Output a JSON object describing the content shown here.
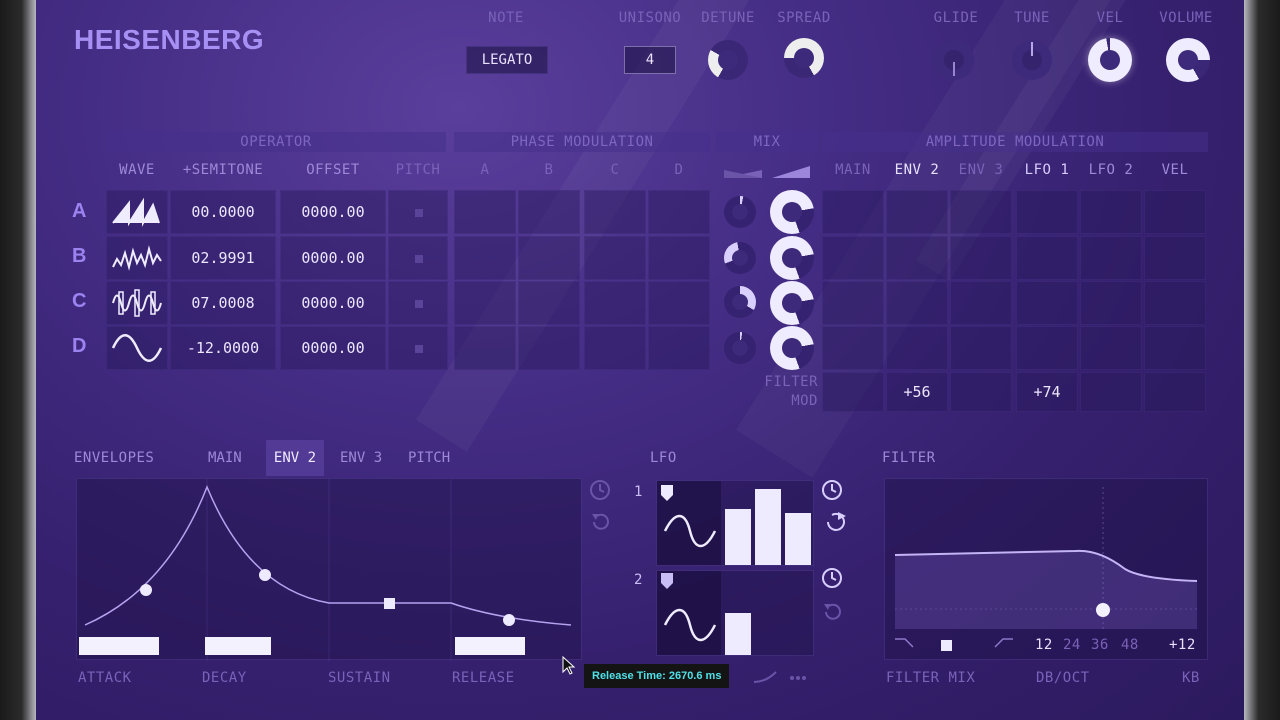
{
  "app": {
    "brand": "HEISENBERG"
  },
  "top": {
    "note_label": "NOTE",
    "note_value": "LEGATO",
    "unison_label": "UNISONO",
    "unison_value": "4",
    "detune_label": "DETUNE",
    "spread_label": "SPREAD",
    "glide_label": "GLIDE",
    "tune_label": "TUNE",
    "vel_label": "VEL",
    "volume_label": "VOLUME"
  },
  "sections": {
    "operator": "OPERATOR",
    "phase_mod": "PHASE MODULATION",
    "mix": "MIX",
    "amp_mod": "AMPLITUDE MODULATION"
  },
  "columns": {
    "wave": "WAVE",
    "semitone": "+SEMITONE",
    "offset": "OFFSET",
    "pitch": "PITCH",
    "pm": [
      "A",
      "B",
      "C",
      "D"
    ],
    "am": [
      "MAIN",
      "ENV 2",
      "ENV 3",
      "LFO 1",
      "LFO 2",
      "VEL"
    ]
  },
  "operators": [
    {
      "letter": "A",
      "semitone": "00.0000",
      "offset": "0000.00",
      "wave_icon": "saw-wave-icon"
    },
    {
      "letter": "B",
      "semitone": "02.9991",
      "offset": "0000.00",
      "wave_icon": "noise-wave-icon"
    },
    {
      "letter": "C",
      "semitone": "07.0008",
      "offset": "0000.00",
      "wave_icon": "complex-wave-icon"
    },
    {
      "letter": "D",
      "semitone": "-12.0000",
      "offset": "0000.00",
      "wave_icon": "sine-wave-icon"
    }
  ],
  "filter_mod": {
    "label_line1": "FILTER",
    "label_line2": "MOD",
    "env2": "+56",
    "lfo1": "+74"
  },
  "envelopes": {
    "label": "ENVELOPES",
    "tabs": [
      "MAIN",
      "ENV 2",
      "ENV 3",
      "PITCH"
    ],
    "active_tab": "ENV 2",
    "params": [
      "ATTACK",
      "DECAY",
      "SUSTAIN",
      "RELEASE"
    ]
  },
  "lfo": {
    "label": "LFO",
    "rows": [
      "1",
      "2"
    ]
  },
  "filter": {
    "label": "FILTER",
    "slopes": [
      "12",
      "24",
      "36",
      "48"
    ],
    "active_slope": "12",
    "kb_value": "+12",
    "bottom_labels": [
      "FILTER MIX",
      "DB/OCT",
      "KB"
    ]
  },
  "tooltip": {
    "text": "Release Time: 2670.6 ms"
  },
  "colors": {
    "panel": "#432c83",
    "accent": "#a790f3",
    "bright": "#eeeaff",
    "tooltip_text": "#4fe0e8"
  }
}
